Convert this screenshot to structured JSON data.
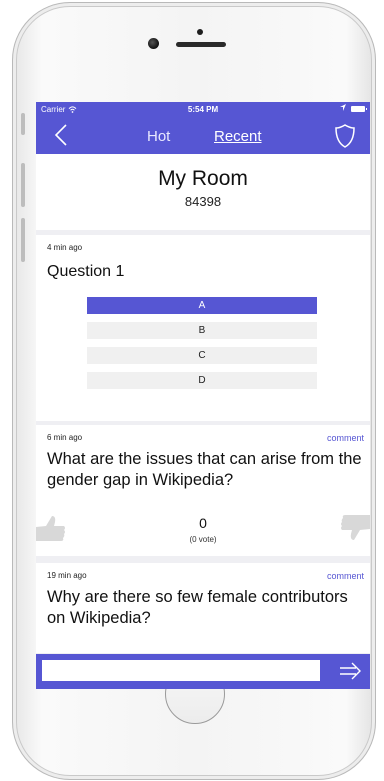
{
  "status_bar": {
    "carrier": "Carrier",
    "time": "5:54 PM"
  },
  "navbar": {
    "tabs": [
      {
        "label": "Hot",
        "active": false
      },
      {
        "label": "Recent",
        "active": true
      }
    ],
    "icons": [
      "chevron-left-icon",
      "shield-icon"
    ]
  },
  "room": {
    "title": "My Room",
    "code": "84398"
  },
  "posts": [
    {
      "time": "4 min ago",
      "title": "Question 1",
      "options": [
        "A",
        "B",
        "C",
        "D"
      ],
      "selected_option": "A"
    },
    {
      "time": "6 min ago",
      "comment_label": "comment",
      "text": "What are the issues that can arise from the gender gap in Wikipedia?",
      "votes": "0",
      "votes_sub": "(0 vote)"
    },
    {
      "time": "19 min ago",
      "comment_label": "comment",
      "text": "Why are there so few female contributors on Wikipedia?"
    }
  ],
  "input": {
    "value": "",
    "placeholder": ""
  },
  "colors": {
    "accent": "#5656d3",
    "background": "#efeff3",
    "card": "#ffffff",
    "option_bg": "#f0f0f0"
  }
}
